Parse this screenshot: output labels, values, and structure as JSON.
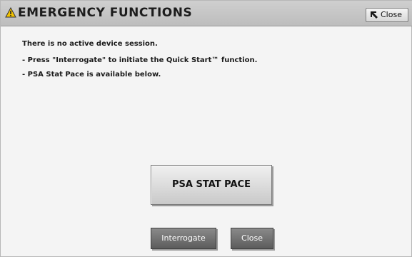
{
  "window": {
    "title": "EMERGENCY FUNCTIONS",
    "close_label": "Close"
  },
  "messages": {
    "line1": "There is no active device session.",
    "line2": "- Press \"Interrogate\" to initiate the Quick Start™ function.",
    "line3": "- PSA Stat Pace is available below."
  },
  "buttons": {
    "psa_stat_pace": "PSA STAT PACE",
    "interrogate": "Interrogate",
    "close": "Close"
  },
  "icons": {
    "title": "warning-icon",
    "close": "close-arrow-icon"
  }
}
